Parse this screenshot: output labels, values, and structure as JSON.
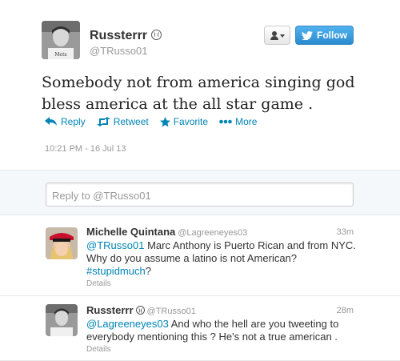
{
  "tweet": {
    "author_name": "Russterrr",
    "author_handle": "@TRusso01",
    "text": "Somebody not from america singing god bless america at the all star game .",
    "timestamp": "10:21 PM - 16 Jul 13",
    "actions": {
      "reply": "Reply",
      "retweet": "Retweet",
      "favorite": "Favorite",
      "more": "More"
    }
  },
  "header_buttons": {
    "follow_label": "Follow"
  },
  "reply_box": {
    "placeholder": "Reply to @TRusso01"
  },
  "replies": [
    {
      "name": "Michelle Quintana",
      "handle": "@Lagreeneyes03",
      "time": "33m",
      "mention": "@TRusso01",
      "text": " Marc Anthony is Puerto Rican and from NYC. Why do you assume a latino is not American?",
      "hashtag": "#stupidmuch",
      "hashtag_suffix": "?",
      "details": "Details"
    },
    {
      "name": "Russterrr",
      "handle": "@TRusso01",
      "time": "28m",
      "mention": "@Lagreeneyes03",
      "text": " And who the hell are you tweeting to everybody mentioning this ? He's not a true american .",
      "details": "Details"
    }
  ],
  "colors": {
    "link": "#0084b4",
    "follow_button": "#2b8ad0"
  }
}
